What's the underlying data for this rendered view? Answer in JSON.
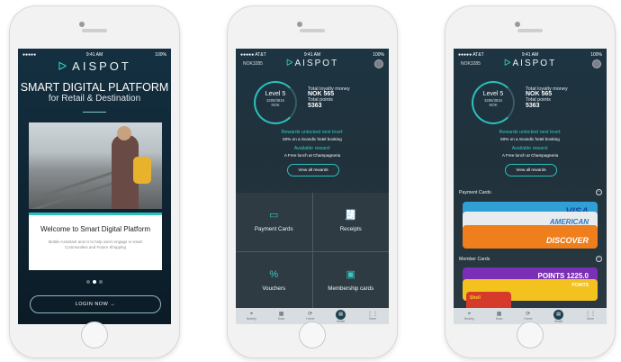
{
  "status": {
    "carrier": "●●●●● AT&T",
    "carrier_short": "●●●●●",
    "time": "9:41 AM",
    "battery": "100%"
  },
  "brand": {
    "name": "AISPOT",
    "mark": "ᐅ"
  },
  "onboarding": {
    "headline": "SMART DIGITAL PLATFORM",
    "subline": "for Retail & Destination",
    "card_title": "Welcome to Smart Digital Platform",
    "card_body": "Mobile Assistant and AI to help users engage in smart Communities and Future Shopping",
    "login_label": "LOGIN NOW →"
  },
  "dashboard": {
    "nok_code": "NOK3285",
    "level": "Level 5",
    "points_ratio": "3285/3816",
    "currency": "NOK",
    "loyalty_label": "Total loyalty money",
    "loyalty_value": "NOK 565",
    "points_label": "Total points",
    "points_value": "5363",
    "rewards_title": "Rewards unlocked next level:",
    "rewards_text": "50% on a Scandic hotel booking",
    "available_title": "Available reward:",
    "available_text": "A Free lunch at Champagneria",
    "view_rewards": "View all rewards"
  },
  "tiles": [
    {
      "label": "Payment Cards",
      "icon": "▭"
    },
    {
      "label": "Receipts",
      "icon": "🧾"
    },
    {
      "label": "Vouchers",
      "icon": "%"
    },
    {
      "label": "Membership cards",
      "icon": "▣"
    }
  ],
  "tabs": [
    {
      "label": "Nearby",
      "icon": "⌖"
    },
    {
      "label": "Scan",
      "icon": "▦"
    },
    {
      "label": "Home",
      "icon": "⟳"
    },
    {
      "label": "Wallet",
      "icon": "▤"
    },
    {
      "label": "More",
      "icon": "⋮⋮"
    }
  ],
  "wallet": {
    "payment_section": "Payment Cards",
    "member_section": "Member Cards",
    "payment_cards": [
      {
        "label": "VISA",
        "color": "#2f9fd4",
        "text": "#1a4aa0"
      },
      {
        "label": "AMERICAN",
        "color": "#e9ecee",
        "text": "#2e76c0"
      },
      {
        "label": "DISCOVER",
        "color": "#ef7e1c",
        "text": "#ffffff"
      }
    ],
    "member_cards": [
      {
        "label": "POINTS 1225.0",
        "color": "#7a2fb6"
      },
      {
        "label": "POINTS",
        "color": "#f3c21f"
      },
      {
        "label": "Shell",
        "color": "#1f9a52"
      }
    ]
  },
  "colors": {
    "accent": "#2bc0bb",
    "dark_bg": "#0e1d27"
  }
}
